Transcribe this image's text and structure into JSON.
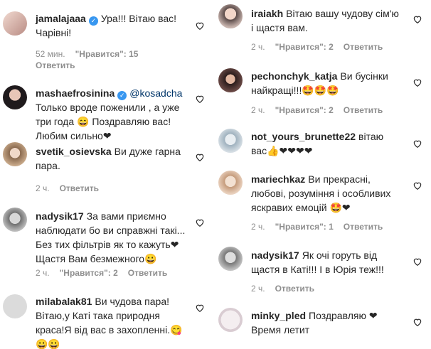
{
  "left": [
    {
      "user": "jamalajaaa",
      "verified": true,
      "lines": [
        "Ура!!! Вітаю вас!",
        "Чарівні!"
      ],
      "time": "52 мин.",
      "likes": "\"Нравится\": 15",
      "reply": "Ответить"
    },
    {
      "user": "mashaefrosinina",
      "verified": true,
      "mention": "@kosadcha",
      "lines": [
        "Только вроде поженили , а уже",
        "три года 😄 Поздравляю вас!",
        "Любим сильно❤"
      ]
    },
    {
      "user": "svetik_osievska",
      "lines": [
        "Ви дуже гарна",
        "пара."
      ],
      "time": "2 ч.",
      "reply": "Ответить"
    },
    {
      "user": "nadysik17",
      "lines": [
        "За вами приємно",
        "наблюдати бо ви справжні такі...",
        "Без тих фільтрів як то кажуть❤",
        "Щастя Вам безмежного😀"
      ],
      "time": "2 ч.",
      "likes": "\"Нравится\": 2",
      "reply": "Ответить"
    },
    {
      "user": "milabalak81",
      "lines": [
        "Ви чудова пара!",
        "Вітаю,у Каті така природня",
        "краса!Я від вас в захопленні.😋",
        "😀😀"
      ]
    }
  ],
  "right": [
    {
      "user": "iraiakh",
      "lines": [
        "Вітаю вашу чудову сім'ю",
        "і щастя вам."
      ],
      "time": "2 ч.",
      "likes": "\"Нравится\": 2",
      "reply": "Ответить"
    },
    {
      "user": "pechonchyk_katja",
      "lines": [
        "Ви бусінки",
        "найкращі!!!🤩🤩🤩"
      ],
      "time": "2 ч.",
      "likes": "\"Нравится\": 2",
      "reply": "Ответить"
    },
    {
      "user": "not_yours_brunette22",
      "lines": [
        "вітаю",
        "вас👍❤❤❤❤"
      ]
    },
    {
      "user": "mariechkaz",
      "lines": [
        "Ви прекрасні,",
        "любові, розуміння і особливих",
        "яскравих емоцій 🤩❤"
      ],
      "time": "2 ч.",
      "likes": "\"Нравится\": 1",
      "reply": "Ответить"
    },
    {
      "user": "nadysik17",
      "lines": [
        "Як очі горуть від",
        "щастя в Каті!!! І в Юрія теж!!!"
      ],
      "time": "2 ч.",
      "reply": "Ответить"
    },
    {
      "user": "minky_pled",
      "lines": [
        "Поздравляю ❤",
        "Время летит"
      ]
    }
  ]
}
